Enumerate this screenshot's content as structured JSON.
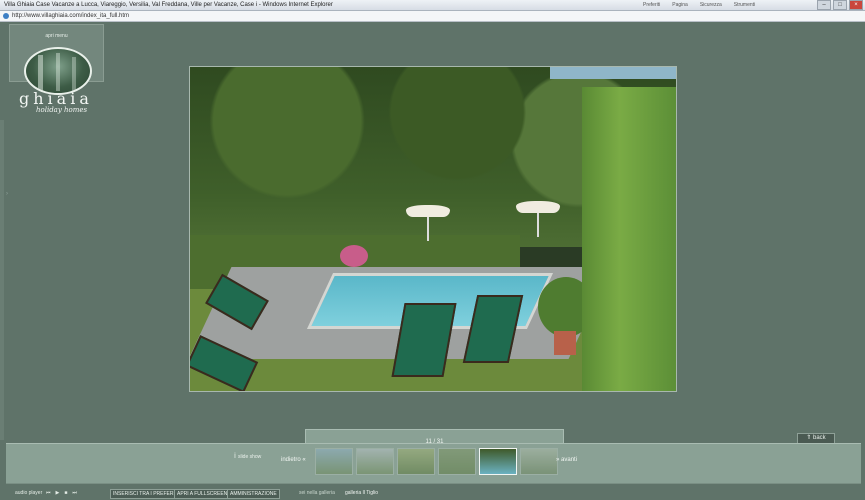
{
  "browser": {
    "title": "Villa Ghiaia Case Vacanze a Lucca, Viareggio, Versilia, Val Freddana, Ville per Vacanze, Case i - Windows Internet Explorer",
    "url": "http://www.villaghiaia.com/index_ita_full.htm",
    "tabs": [
      "Preferiti",
      "Pagina",
      "Sicurezza",
      "Strumenti"
    ],
    "window_controls": [
      "–",
      "□",
      "×"
    ]
  },
  "site": {
    "menu_label": "apri menu",
    "brand_name": "ghiaia",
    "brand_tagline": "holiday homes"
  },
  "slideshow": {
    "counter": "11 / 31",
    "back_label": "back",
    "slide_show_label": "slide show",
    "prev_label": "indietro",
    "next_label": "avanti",
    "thumbnail_count": 6,
    "active_thumbnail": 5
  },
  "footer": {
    "audio_label": "audio player",
    "audio_controls": [
      "⏮",
      "▶",
      "■",
      "⏭"
    ],
    "buttons": [
      "INSERISCI TRA I PREFERITI",
      "APRI A FULLSCREEN",
      "AMMINISTRAZIONE"
    ],
    "gallery_label": "sei nella galleria",
    "gallery_name": "galleria Il Tiglio"
  },
  "colors": {
    "background": "#5f7369",
    "panel": "#8aa195",
    "text": "#f2f6f3"
  }
}
